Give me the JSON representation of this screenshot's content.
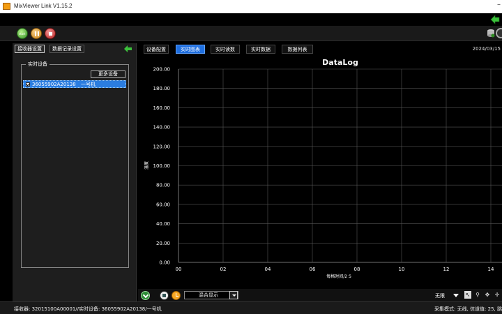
{
  "window": {
    "title": "MixViewer Link V1.15.2",
    "minimize_glyph": "–"
  },
  "toolbar": {
    "start_label": "start"
  },
  "left": {
    "tabs": [
      "接收器设置",
      "数据记录设置"
    ],
    "group_title": "实时设备",
    "more_button": "更多设备",
    "device": {
      "sn": "36055902A20138",
      "name": "一号机",
      "checked": true
    }
  },
  "right": {
    "tabs": [
      "设备配置",
      "实时图表",
      "实时读数",
      "实时数据",
      "数据列表"
    ],
    "active_tab": "实时图表",
    "date": "2024/03/15"
  },
  "chart_data": {
    "type": "line",
    "title": "DataLog",
    "ylabel": "温度",
    "xlabel": "每格时间/2 S",
    "ylim": [
      0,
      200
    ],
    "yticks": [
      "200.00",
      "180.00",
      "160.00",
      "140.00",
      "120.00",
      "100.00",
      "80.00",
      "60.00",
      "40.00",
      "20.00",
      "0.00"
    ],
    "xticks": [
      "00",
      "02",
      "04",
      "06",
      "08",
      "10",
      "12",
      "14"
    ],
    "grid": true,
    "series": []
  },
  "bottom": {
    "display_mode": "混合显示",
    "limit": "无限"
  },
  "status": {
    "left": "接收器: 32015100A00001//实时设备: 36055902A20138/一号机",
    "right": "采集模式: 无线, 信道值: 25, 跳"
  },
  "colors": {
    "accent": "#1f6fe0",
    "grid": "#555555"
  }
}
